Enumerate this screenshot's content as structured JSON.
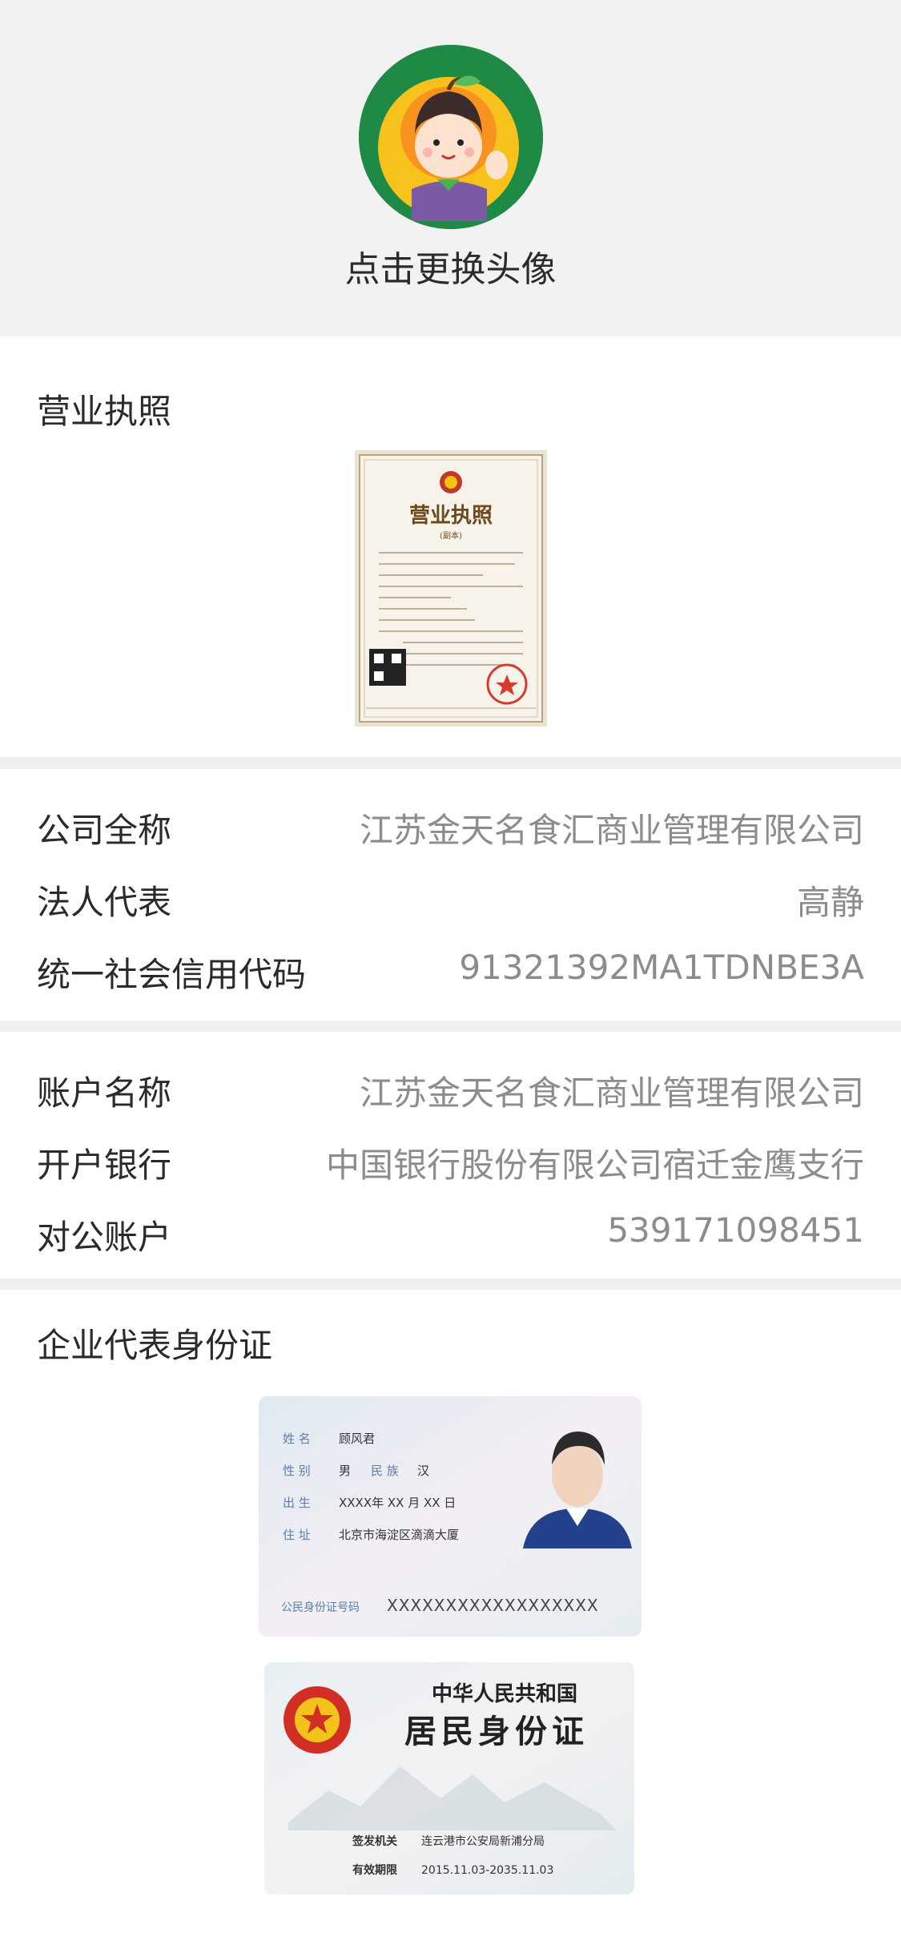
{
  "header": {
    "avatar_label": "点击更换头像"
  },
  "license": {
    "title": "营业执照",
    "doc_title": "营业执照",
    "doc_sub": "(副本)"
  },
  "company": {
    "rows": [
      {
        "label": "公司全称",
        "value": "江苏金天名食汇商业管理有限公司"
      },
      {
        "label": "法人代表",
        "value": "高静"
      },
      {
        "label": "统一社会信用代码",
        "value": "91321392MA1TDNBE3A"
      }
    ]
  },
  "bank": {
    "rows": [
      {
        "label": "账户名称",
        "value": "江苏金天名食汇商业管理有限公司"
      },
      {
        "label": "开户银行",
        "value": "中国银行股份有限公司宿迁金鹰支行"
      },
      {
        "label": "对公账户",
        "value": "539171098451"
      }
    ]
  },
  "idcard": {
    "title": "企业代表身份证",
    "front": {
      "name_label": "姓 名",
      "name": "顾风君",
      "gender_label": "性 别",
      "gender": "男",
      "ethnic_label": "民 族",
      "ethnic": "汉",
      "birth_label": "出 生",
      "birth": "XXXX年 XX 月 XX 日",
      "addr_label": "住 址",
      "addr": "北京市海淀区滴滴大厦",
      "id_label": "公民身份证号码",
      "id_number": "XXXXXXXXXXXXXXXXXX"
    },
    "back": {
      "country": "中华人民共和国",
      "card_name": "居民身份证",
      "issuer_label": "签发机关",
      "issuer": "连云港市公安局新浦分局",
      "valid_label": "有效期限",
      "valid": "2015.11.03-2035.11.03"
    }
  },
  "colors": {
    "avatar_bg": "#1e8a45",
    "orange": "#f7931e",
    "value_gray": "#8c8c8c",
    "divider": "#efefef"
  }
}
